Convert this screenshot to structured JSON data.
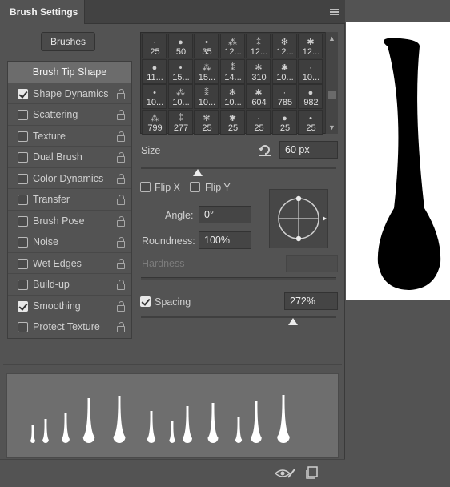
{
  "panel": {
    "title": "Brush Settings",
    "brushes_button": "Brushes"
  },
  "options": [
    {
      "label": "Brush Tip Shape",
      "checked": null,
      "lock": false
    },
    {
      "label": "Shape Dynamics",
      "checked": true,
      "lock": true
    },
    {
      "label": "Scattering",
      "checked": false,
      "lock": true
    },
    {
      "label": "Texture",
      "checked": false,
      "lock": true
    },
    {
      "label": "Dual Brush",
      "checked": false,
      "lock": true
    },
    {
      "label": "Color Dynamics",
      "checked": false,
      "lock": true
    },
    {
      "label": "Transfer",
      "checked": false,
      "lock": true
    },
    {
      "label": "Brush Pose",
      "checked": false,
      "lock": true
    },
    {
      "label": "Noise",
      "checked": false,
      "lock": true
    },
    {
      "label": "Wet Edges",
      "checked": false,
      "lock": true
    },
    {
      "label": "Build-up",
      "checked": false,
      "lock": true
    },
    {
      "label": "Smoothing",
      "checked": true,
      "lock": true
    },
    {
      "label": "Protect Texture",
      "checked": false,
      "lock": true
    }
  ],
  "brush_tips": [
    [
      "25",
      "50",
      "35",
      "12...",
      "12...",
      "12...",
      "12..."
    ],
    [
      "11...",
      "15...",
      "15...",
      "14...",
      "310",
      "10...",
      "10..."
    ],
    [
      "10...",
      "10...",
      "10...",
      "10...",
      "604",
      "785",
      "982"
    ],
    [
      "799",
      "277",
      "25",
      "25",
      "25",
      "25",
      "25"
    ]
  ],
  "size": {
    "label": "Size",
    "value": "60 px",
    "slider_fraction": 0.29
  },
  "flip_x": {
    "label": "Flip X",
    "checked": false
  },
  "flip_y": {
    "label": "Flip Y",
    "checked": false
  },
  "angle": {
    "label": "Angle:",
    "value": "0°"
  },
  "roundness": {
    "label": "Roundness:",
    "value": "100%"
  },
  "hardness": {
    "label": "Hardness",
    "value": ""
  },
  "spacing": {
    "label": "Spacing",
    "checked": true,
    "value": "272%",
    "slider_fraction": 0.78
  },
  "icons": {
    "menu": "panel-menu-icon",
    "reset": "reset-size-icon",
    "toggle_preview": "eye-brush-icon",
    "new_preset": "new-preset-icon"
  }
}
